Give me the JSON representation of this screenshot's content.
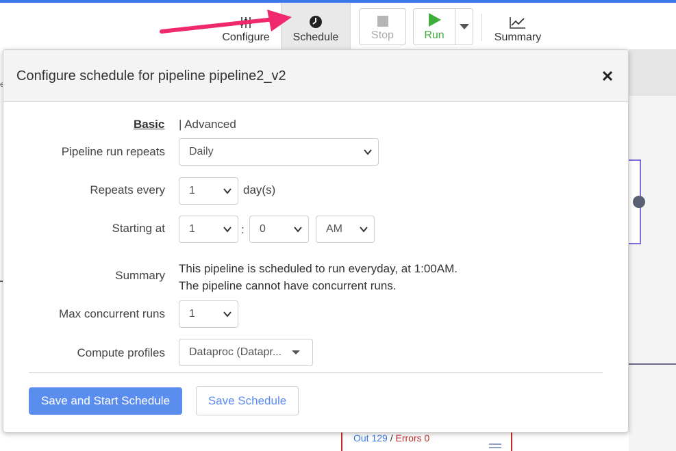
{
  "toolbar": {
    "configure_label": "Configure",
    "schedule_label": "Schedule",
    "stop_label": "Stop",
    "run_label": "Run",
    "summary_label": "Summary"
  },
  "modal": {
    "title": "Configure schedule for pipeline pipeline2_v2",
    "tabs": {
      "basic": "Basic",
      "advanced": "| Advanced"
    },
    "fields": {
      "run_repeats_label": "Pipeline run repeats",
      "run_repeats_value": "Daily",
      "repeats_every_label": "Repeats every",
      "repeats_every_value": "1",
      "repeats_every_unit": "day(s)",
      "starting_at_label": "Starting at",
      "starting_hour": "1",
      "starting_minute": "0",
      "starting_ampm": "AM",
      "time_separator": ":",
      "summary_label": "Summary",
      "summary_line1": "This pipeline is scheduled to run everyday, at 1:00AM.",
      "summary_line2": "The pipeline cannot have concurrent runs.",
      "max_concurrent_label": "Max concurrent runs",
      "max_concurrent_value": "1",
      "compute_profiles_label": "Compute profiles",
      "compute_profiles_value": "Dataproc (Datapr..."
    },
    "buttons": {
      "save_start": "Save and Start Schedule",
      "save": "Save Schedule"
    }
  },
  "background_node": {
    "out_label": "Out 129",
    "separator": " / ",
    "errors_label": "Errors 0"
  },
  "left_letter": "e",
  "colors": {
    "accent": "#3b78e7",
    "primary_button": "#5b8def",
    "run_green": "#3fae3c",
    "annotation_arrow": "#f0286e",
    "error_red": "#c12a2a"
  },
  "icons": {
    "configure": "sliders-icon",
    "schedule": "clock-icon",
    "stop": "stop-square-icon",
    "run": "play-icon",
    "run_dropdown": "caret-down-icon",
    "summary": "line-chart-icon",
    "close": "close-icon"
  }
}
